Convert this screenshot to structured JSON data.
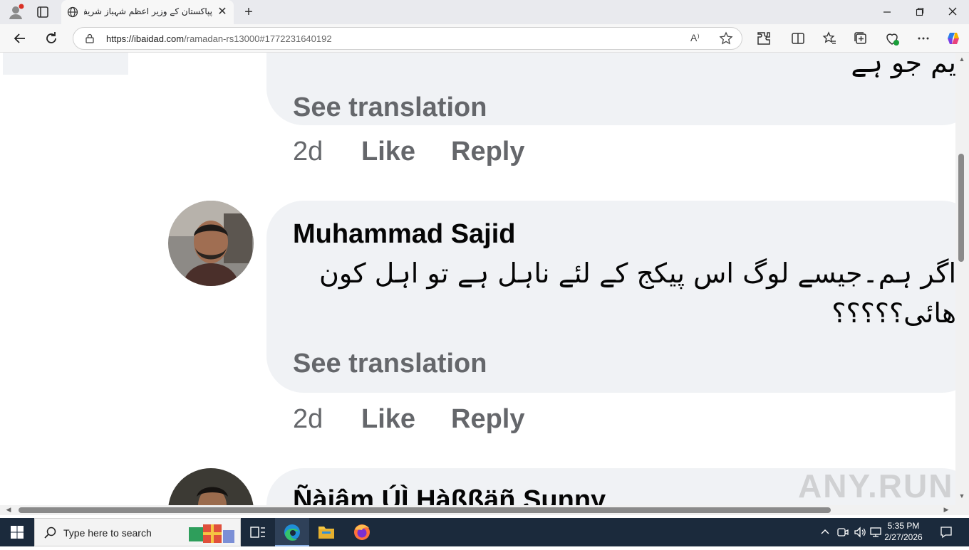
{
  "browser": {
    "tab": {
      "title": "پپاکستان کے وزیر اعظم شہباز شریف",
      "close_glyph": "✕"
    },
    "new_tab_glyph": "+",
    "url": {
      "domain": "https://ibaidad.com",
      "path": "/ramadan-rs13000#1772231640192"
    },
    "read_aloud_label": "A⁾"
  },
  "comments": [
    {
      "partial_text": "یم جو ہے",
      "see_translation": "See translation",
      "time": "2d",
      "like": "Like",
      "reply": "Reply"
    },
    {
      "author": "Muhammad Sajid",
      "text_line1": "اگر ہم۔جیسے لوگ اس پیکج کے لئے ناہل ہے تو اہل کون",
      "text_line2": "ھائی؟؟؟؟؟",
      "see_translation": "See translation",
      "time": "2d",
      "like": "Like",
      "reply": "Reply"
    },
    {
      "author": "Ñàjâm ÚÌ Hàßßäñ Sunny"
    }
  ],
  "watermark": "ANY.RUN",
  "taskbar": {
    "search_placeholder": "Type here to search",
    "time": "5:35 PM",
    "date": "2/27/2026"
  },
  "colors": {
    "bubble_bg": "#f0f2f5",
    "secondary_text": "#65676b",
    "primary_text": "#050505",
    "taskbar_bg": "#1b2a3c"
  }
}
